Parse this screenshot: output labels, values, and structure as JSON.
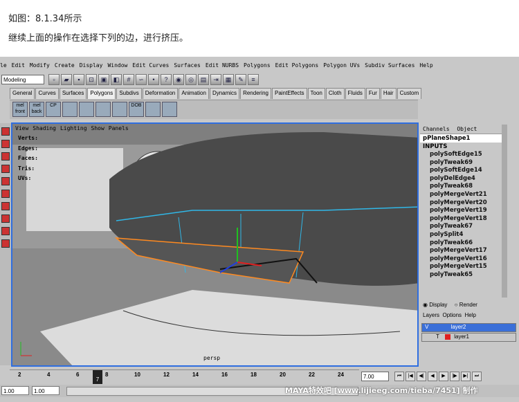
{
  "caption": {
    "line1": "如图：8.1.34所示",
    "line2": "继续上面的操作在选择下列的边，进行挤压。"
  },
  "menubar": [
    "le",
    "Edit",
    "Modify",
    "Create",
    "Display",
    "Window",
    "Edit Curves",
    "Surfaces",
    "Edit NURBS",
    "Polygons",
    "Edit Polygons",
    "Polygon UVs",
    "Subdiv Surfaces",
    "Help"
  ],
  "toolbar": {
    "mode": "Modeling",
    "sel_label": "sel"
  },
  "shelf_tabs": [
    "General",
    "Curves",
    "Surfaces",
    "Polygons",
    "Subdivs",
    "Deformation",
    "Animation",
    "Dynamics",
    "Rendering",
    "PaintEffects",
    "Toon",
    "Cloth",
    "Fluids",
    "Fur",
    "Hair",
    "Custom"
  ],
  "shelf_buttons": [
    "mel front",
    "mel back",
    "CP",
    "",
    "",
    "",
    "",
    "DOB",
    "",
    ""
  ],
  "viewport": {
    "menu": [
      "View",
      "Shading",
      "Lighting",
      "Show",
      "Panels"
    ],
    "hud": [
      "Verts:",
      "Edges:",
      "Faces:",
      "Tris:",
      "UVs:"
    ],
    "camera": "persp"
  },
  "channel_box": {
    "tabs": [
      "Channels",
      "Object"
    ],
    "shape": "pPlaneShape1",
    "inputs_label": "INPUTS",
    "history": [
      "polySoftEdge15",
      "polyTweak69",
      "polySoftEdge14",
      "polyDelEdge4",
      "polyTweak68",
      "polyMergeVert21",
      "polyMergeVert20",
      "polyMergeVert19",
      "polyMergeVert18",
      "polyTweak67",
      "polySplit4",
      "polyTweak66",
      "polyMergeVert17",
      "polyMergeVert16",
      "polyMergeVert15",
      "polyTweak65"
    ]
  },
  "layers": {
    "display_label": "Display",
    "render_label": "Render",
    "menu": [
      "Layers",
      "Options",
      "Help"
    ],
    "rows": [
      {
        "v": "V",
        "t": "",
        "name": "layer2",
        "color": "#3a6fd8"
      },
      {
        "v": "",
        "t": "T",
        "name": "layer1",
        "color": "#e02020"
      }
    ]
  },
  "timeline": {
    "ticks": [
      "2",
      "4",
      "6",
      "8",
      "10",
      "12",
      "14",
      "16",
      "18",
      "20",
      "22",
      "24"
    ],
    "current_frame": "7",
    "current_time": "7.00"
  },
  "range": {
    "start": "1.00",
    "end": "1.00"
  },
  "watermark": "MAYA特效吧 [www.lijieeg.com/tieba/7451] 制作"
}
